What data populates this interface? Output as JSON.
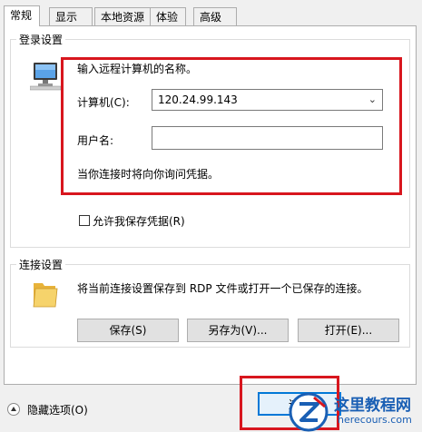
{
  "tabs": [
    "常规",
    "显示",
    "本地资源",
    "体验",
    "高级"
  ],
  "login_group": {
    "legend": "登录设置",
    "instruction": "输入远程计算机的名称。",
    "computer_label": "计算机(C):",
    "computer_value": "120.24.99.143",
    "username_label": "用户名:",
    "username_value": "",
    "prompt_note": "当你连接时将向你询问凭据。",
    "save_credentials_label": "允许我保存凭据(R)"
  },
  "connection_group": {
    "legend": "连接设置",
    "description": "将当前连接设置保存到 RDP 文件或打开一个已保存的连接。",
    "save_button": "保存(S)",
    "save_as_button": "另存为(V)...",
    "open_button": "打开(E)..."
  },
  "footer": {
    "hide_options_label": "隐藏选项(O)",
    "connect_button": "连接"
  },
  "watermark": {
    "title": "这里教程网",
    "url": "herecours.com"
  },
  "icons": {
    "computer": "computer-monitor-icon",
    "folder": "folder-icon",
    "collapse": "collapse-arrow-icon",
    "logo": "z-logo-icon"
  },
  "colors": {
    "highlight": "#d8161e",
    "accent": "#0078d7",
    "watermark": "#1a5fb4"
  }
}
